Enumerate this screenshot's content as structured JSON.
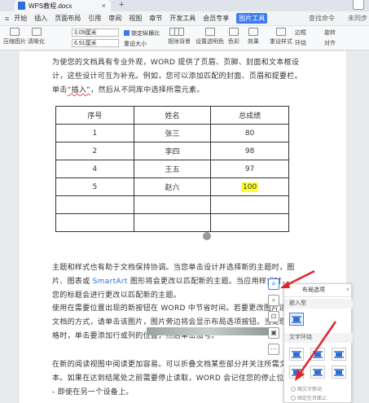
{
  "window": {
    "doc_title": "WPS教程.docx",
    "close_glyph": "×",
    "new_tab_glyph": "+"
  },
  "menu": {
    "items": [
      "开始",
      "插入",
      "页面布局",
      "引用",
      "审阅",
      "视图",
      "章节",
      "开发工具",
      "会员专享",
      "图片工具"
    ],
    "active_index": 9,
    "search": "查找命令",
    "share": "未同步"
  },
  "ribbon": {
    "btn_preview": "压缩图片",
    "btn_sharpen": "清晰化",
    "height_value": "3.09厘米",
    "width_value": "6.91厘米",
    "lock_ratio": "锁定纵横比",
    "reset_size": "重设大小",
    "btn_crop": "裁剪",
    "btn_remove_bg": "抠除背景",
    "btn_set_transparent": "设置透明色",
    "btn_color": "色彩",
    "btn_effects": "效果",
    "btn_border": "边框",
    "btn_reset_style": "重设样式",
    "btn_wrap": "环绕",
    "btn_align": "对齐",
    "btn_rotate": "旋转",
    "btn_group": "组合"
  },
  "doc": {
    "p1_a": "为使您的文档具有专业外观，WORD 提供了页眉、页脚、封面和文本框设计，这些设计可互为补充。例如，您可以添加匹配的封面、页眉和提要栏。单击",
    "p1_b": "“插入”",
    "p1_c": "，然后从不同库中选择所需元素。",
    "table": {
      "headers": [
        "序号",
        "姓名",
        "总成绩"
      ],
      "rows": [
        [
          "1",
          "张三",
          "80"
        ],
        [
          "2",
          "李四",
          "98"
        ],
        [
          "4",
          "王五",
          "97"
        ],
        [
          "5",
          "赵六",
          "100"
        ]
      ]
    },
    "p2_a": "主题和样式也有助于文档保持协调。当您单击设计并选择新的主题时，图片、图表或 ",
    "p2_link": "SmartArt",
    "p2_b": " 图形将会更改以匹配新的主题。当应用样式时，您的标题会进行更改以匹配新的主题。",
    "p3": "使用在需要位置出现的新按钮在 WORD 中节省时间。若要更改图片适应文档的方式，请单击该图片，图片旁边将会显示布局选项按钮。当处理表格时，单击要添加行或列的位置，然后单击加号。",
    "p4": "在新的阅读视图中阅读更加容易。可以折叠文档某些部分并关注所需文本。如果在达到结尾处之前需要停止读取，WORD 会记住您的停止位置 - 即使在另一个设备上。"
  },
  "popup": {
    "title": "布局选项",
    "close": "×",
    "section_inline": "嵌入型",
    "section_wrap": "文字环绕",
    "radio_move": "随文字移动",
    "radio_fixed": "固定在页面上"
  },
  "colors": {
    "accent": "#3b7bef",
    "arrow": "#e0242b",
    "highlight": "#ffff33"
  }
}
